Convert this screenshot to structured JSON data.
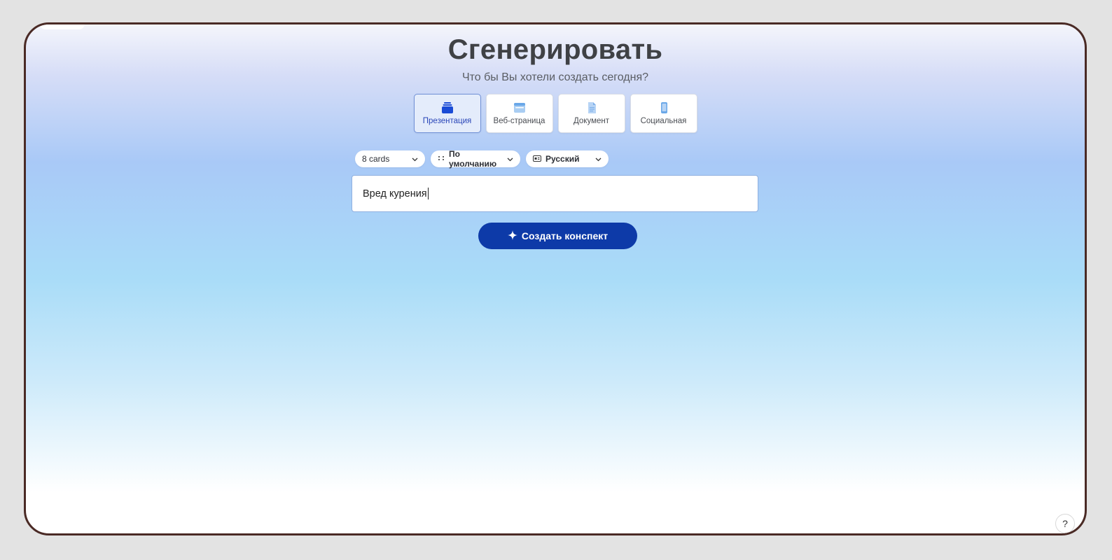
{
  "header": {
    "title": "Сгенерировать",
    "subtitle": "Что бы Вы хотели создать сегодня?"
  },
  "content_types": [
    {
      "label": "Презентация",
      "icon": "presentation-icon",
      "active": true
    },
    {
      "label": "Веб-страница",
      "icon": "webpage-icon",
      "active": false
    },
    {
      "label": "Документ",
      "icon": "document-icon",
      "active": false
    },
    {
      "label": "Социальная",
      "icon": "phone-icon",
      "active": false
    }
  ],
  "controls": {
    "cards": "8 cards",
    "theme": "По умолчанию",
    "language": "Русский"
  },
  "prompt": {
    "value": "Вред курения"
  },
  "generate_button": {
    "label": "Создать конспект"
  },
  "help": {
    "label": "?"
  },
  "colors": {
    "accent": "#0d3aa8",
    "active_card_bg": "#e4ecfb",
    "active_card_border": "#6f8fd6",
    "frame_border": "#4a2a25"
  }
}
